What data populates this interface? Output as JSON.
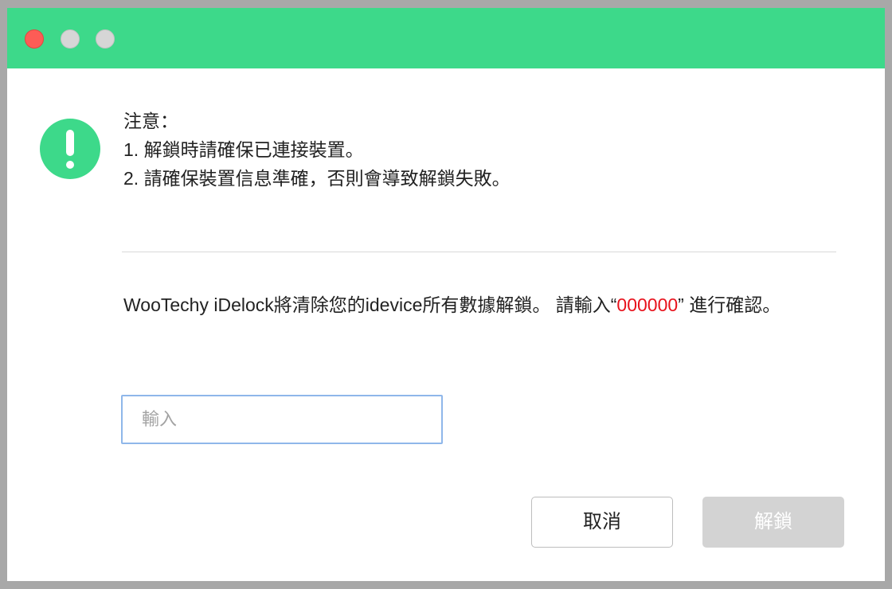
{
  "titlebar": {
    "color": "#3dd98a",
    "traffic_lights": [
      "close",
      "minimize",
      "zoom"
    ]
  },
  "notice": {
    "icon": "exclamation-circle-icon",
    "heading": "注意：",
    "line1": "1. 解鎖時請確保已連接裝置。",
    "line2": "2. 請確保裝置信息準確，否則會導致解鎖失敗。"
  },
  "message": {
    "before_code": "WooTechy iDelock將清除您的idevice所有數據解鎖。 請輸入“",
    "code": "000000",
    "after_code": "” 進行確認。",
    "code_color": "#e8121c"
  },
  "input": {
    "value": "",
    "placeholder": "輸入"
  },
  "buttons": {
    "cancel_label": "取消",
    "unlock_label": "解鎖",
    "unlock_enabled": false
  }
}
